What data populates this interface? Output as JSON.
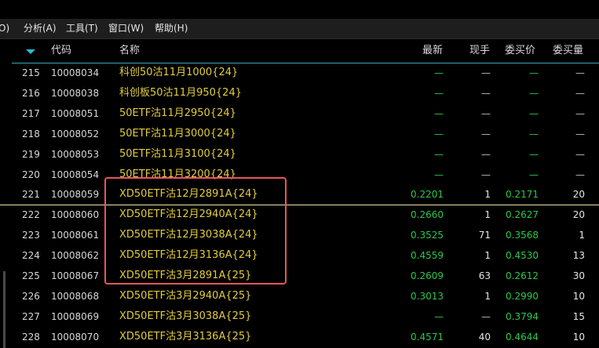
{
  "menubar": {
    "items": [
      {
        "label": "O)"
      },
      {
        "label": "分析(A)"
      },
      {
        "label": "工具(T)"
      },
      {
        "label": "窗口(W)"
      },
      {
        "label": "帮助(H)"
      }
    ]
  },
  "table": {
    "headers": {
      "code": "代码",
      "name": "名称",
      "last": "最新",
      "volume": "现手",
      "bid": "委买价",
      "bid_volume": "委买量"
    },
    "rows": [
      {
        "idx": "215",
        "code": "10008034",
        "name": "科创50沽11月1000{24}",
        "last": "—",
        "volume": "—",
        "bid": "—",
        "bid_volume": "—"
      },
      {
        "idx": "216",
        "code": "10008038",
        "name": "科创板50沽11月950{24}",
        "last": "—",
        "volume": "—",
        "bid": "—",
        "bid_volume": "—"
      },
      {
        "idx": "217",
        "code": "10008051",
        "name": "50ETF沽11月2950{24}",
        "last": "—",
        "volume": "—",
        "bid": "—",
        "bid_volume": "—"
      },
      {
        "idx": "218",
        "code": "10008052",
        "name": "50ETF沽11月3000{24}",
        "last": "—",
        "volume": "—",
        "bid": "—",
        "bid_volume": "—"
      },
      {
        "idx": "219",
        "code": "10008053",
        "name": "50ETF沽11月3100{24}",
        "last": "—",
        "volume": "—",
        "bid": "—",
        "bid_volume": "—"
      },
      {
        "idx": "220",
        "code": "10008054",
        "name": "50ETF沽11月3200{24}",
        "last": "—",
        "volume": "—",
        "bid": "—",
        "bid_volume": "—"
      },
      {
        "idx": "221",
        "code": "10008059",
        "name": "XD50ETF沽12月2891A{24}",
        "last": "0.2201",
        "volume": "1",
        "bid": "0.2171",
        "bid_volume": "20"
      },
      {
        "idx": "222",
        "code": "10008060",
        "name": "XD50ETF沽12月2940A{24}",
        "last": "0.2660",
        "volume": "1",
        "bid": "0.2627",
        "bid_volume": "20"
      },
      {
        "idx": "223",
        "code": "10008061",
        "name": "XD50ETF沽12月3038A{24}",
        "last": "0.3525",
        "volume": "71",
        "bid": "0.3568",
        "bid_volume": "1"
      },
      {
        "idx": "224",
        "code": "10008062",
        "name": "XD50ETF沽12月3136A{24}",
        "last": "0.4559",
        "volume": "1",
        "bid": "0.4530",
        "bid_volume": "13"
      },
      {
        "idx": "225",
        "code": "10008067",
        "name": "XD50ETF沽3月2891A{25}",
        "last": "0.2609",
        "volume": "63",
        "bid": "0.2612",
        "bid_volume": "30"
      },
      {
        "idx": "226",
        "code": "10008068",
        "name": "XD50ETF沽3月2940A{25}",
        "last": "0.3013",
        "volume": "1",
        "bid": "0.2990",
        "bid_volume": "10"
      },
      {
        "idx": "227",
        "code": "10008069",
        "name": "XD50ETF沽3月3038A{25}",
        "last": "—",
        "volume": "—",
        "bid": "0.3794",
        "bid_volume": "15"
      },
      {
        "idx": "228",
        "code": "10008070",
        "name": "XD50ETF沽3月3136A{25}",
        "last": "0.4571",
        "volume": "40",
        "bid": "0.4644",
        "bid_volume": "10"
      }
    ]
  },
  "colors": {
    "background": "#000000",
    "header_underline": "#39a8b8",
    "name_text": "#e2cd3e",
    "price_green": "#2ac84a",
    "highlight_box": "#e8545c",
    "menubar_bg": "#1e1e1e"
  },
  "icons": {
    "sort": "sort-desc-icon"
  }
}
